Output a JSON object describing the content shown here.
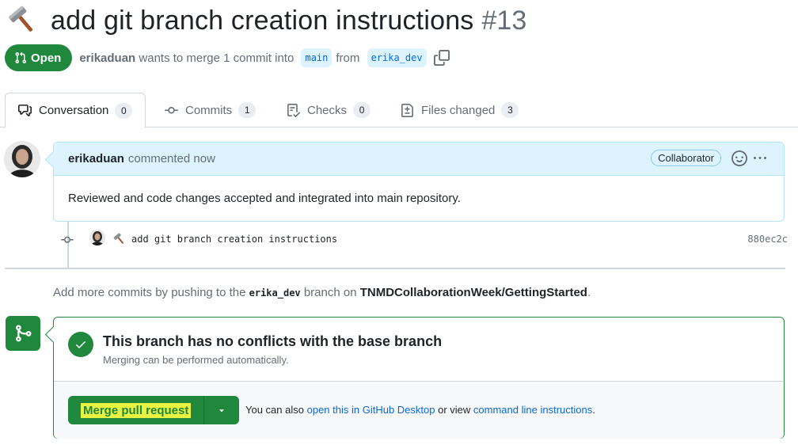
{
  "header": {
    "title": "add git branch creation instructions",
    "number": "#13"
  },
  "meta": {
    "state": "Open",
    "author": "erikaduan",
    "text_1": "wants to merge 1 commit into",
    "base_branch": "main",
    "text_2": "from",
    "head_branch": "erika_dev"
  },
  "tabs": [
    {
      "label": "Conversation",
      "count": "0",
      "icon": "comment-discussion-icon"
    },
    {
      "label": "Commits",
      "count": "1",
      "icon": "git-commit-icon"
    },
    {
      "label": "Checks",
      "count": "0",
      "icon": "checklist-icon"
    },
    {
      "label": "Files changed",
      "count": "3",
      "icon": "file-diff-icon"
    }
  ],
  "comment": {
    "author": "erikaduan",
    "time": "commented now",
    "role": "Collaborator",
    "body": "Reviewed and code changes accepted and integrated into main repository."
  },
  "commit": {
    "message": "add git branch creation instructions",
    "sha": "880ec2c"
  },
  "hint": {
    "prefix": "Add more commits by pushing to the",
    "branch": "erika_dev",
    "middle": "branch on",
    "repo": "TNMDCollaborationWeek/GettingStarted",
    "suffix": "."
  },
  "merge": {
    "heading": "This branch has no conflicts with the base branch",
    "subtext": "Merging can be performed automatically.",
    "button_label": "Merge pull request",
    "also_prefix": "You can also",
    "desktop_link": "open this in GitHub Desktop",
    "also_middle": "or view",
    "cli_link": "command line instructions",
    "also_suffix": "."
  },
  "colors": {
    "green": "#1f883d",
    "blue_link": "#0969da",
    "comment_header_bg": "#ddf4ff",
    "highlight": "#e8f240"
  }
}
